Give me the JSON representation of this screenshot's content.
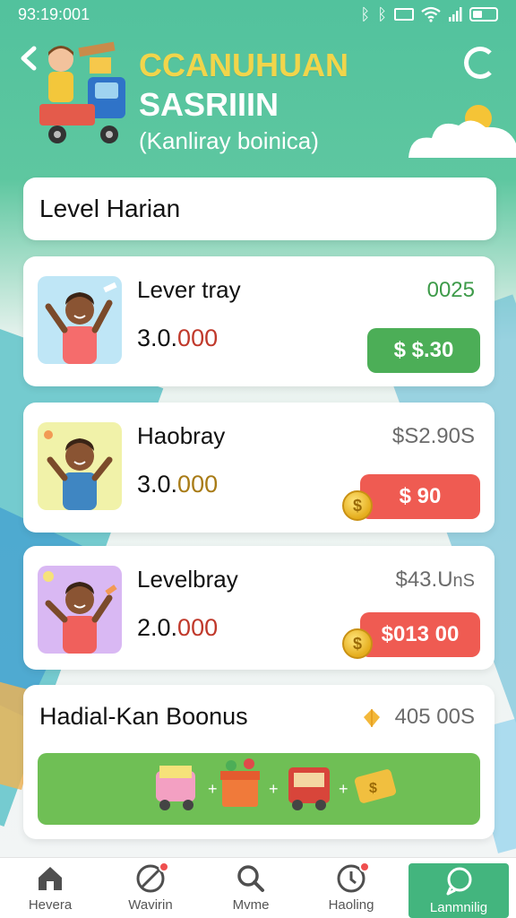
{
  "status_bar": {
    "time": "93:19:001"
  },
  "header": {
    "title": "CCANUHUAN",
    "subtitle": "SASRIIIN",
    "caption": "(Kanliray boinica)"
  },
  "section": {
    "title": "Level Harian"
  },
  "levels": [
    {
      "name": "Lever tray",
      "amount_prefix": "3.0.",
      "amount_highlight": "000",
      "price": "0025",
      "action_label": "$ $.30",
      "avatar_bg": "#bfe6f6",
      "shirt": "#f56c6c"
    },
    {
      "name": "Haobray",
      "amount_prefix": "3.0.",
      "amount_highlight": "000",
      "price": "$S2.90S",
      "action_label": "$ 90",
      "avatar_bg": "#f1f2a9",
      "shirt": "#3f86c2"
    },
    {
      "name": "Levelbray",
      "amount_prefix": "2.0.",
      "amount_highlight": "000",
      "price": "$43.U",
      "price_suffix": "nS",
      "action_label": "$013 00",
      "avatar_bg": "#d9b8f3",
      "shirt": "#f0605c"
    }
  ],
  "bonus": {
    "title": "Hadial-Kan Boonus",
    "value": "405 00S"
  },
  "nav": [
    {
      "label": "Hevera",
      "icon": "home-icon"
    },
    {
      "label": "Wavirin",
      "icon": "ban-icon"
    },
    {
      "label": "Mvme",
      "icon": "search-icon"
    },
    {
      "label": "Haoling",
      "icon": "clock-icon"
    },
    {
      "label": "Lanmnilig",
      "icon": "chat-icon"
    }
  ],
  "colors": {
    "accent": "#43b57e",
    "header": "#52c29d",
    "buy_green": "#4cae57",
    "buy_red": "#ef5b52"
  }
}
